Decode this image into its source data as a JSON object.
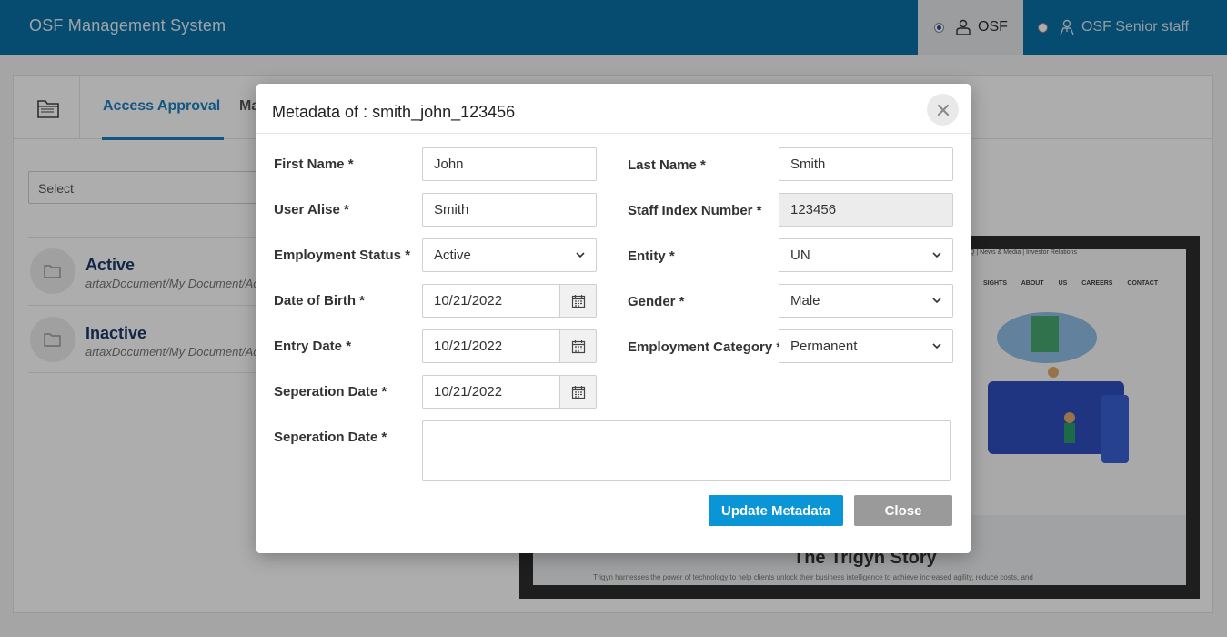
{
  "app": {
    "title": "OSF Management System"
  },
  "roles": [
    {
      "label": "OSF",
      "selected": true
    },
    {
      "label": "OSF Senior staff",
      "selected": false
    }
  ],
  "background": {
    "tabs": [
      "Access Approval",
      "Ma"
    ],
    "select_placeholder": "Select",
    "list": [
      {
        "title": "Active",
        "path": "artaxDocument/My Document/Ac"
      },
      {
        "title": "Inactive",
        "path": "artaxDocument/My Document/Ac"
      }
    ],
    "preview": {
      "nav": "Q   |  News & Media   |  Investor Relations",
      "menu": "SIGHTS ABOUT US CAREERS CONTACT",
      "story_title": "The Trigyn Story",
      "story_sub": "Trigyn harnesses the power of technology to help clients unlock their business intelligence to achieve increased agility, reduce costs, and"
    }
  },
  "modal": {
    "title": "Metadata of : smith_john_123456",
    "fields": {
      "first_name": {
        "label": "First Name *",
        "value": "John"
      },
      "last_name": {
        "label": "Last Name *",
        "value": "Smith"
      },
      "user_alise": {
        "label": "User Alise *",
        "value": "Smith"
      },
      "staff_index": {
        "label": "Staff Index Number *",
        "value": "123456"
      },
      "employment_status": {
        "label": "Employment Status *",
        "value": "Active"
      },
      "entity": {
        "label": "Entity *",
        "value": "UN"
      },
      "dob": {
        "label": "Date of Birth *",
        "value": "10/21/2022"
      },
      "gender": {
        "label": "Gender *",
        "value": "Male"
      },
      "entry_date": {
        "label": "Entry Date *",
        "value": "10/21/2022"
      },
      "employment_category": {
        "label": "Employment Category *",
        "value": "Permanent"
      },
      "separation_date": {
        "label": "Seperation Date *",
        "value": "10/21/2022"
      },
      "separation_note": {
        "label": "Seperation Date *",
        "value": ""
      }
    },
    "buttons": {
      "update": "Update Metadata",
      "close": "Close"
    },
    "colors": {
      "primary": "#0a95d7",
      "secondary": "#9a9a9a",
      "header": "#0a6fa6"
    }
  }
}
